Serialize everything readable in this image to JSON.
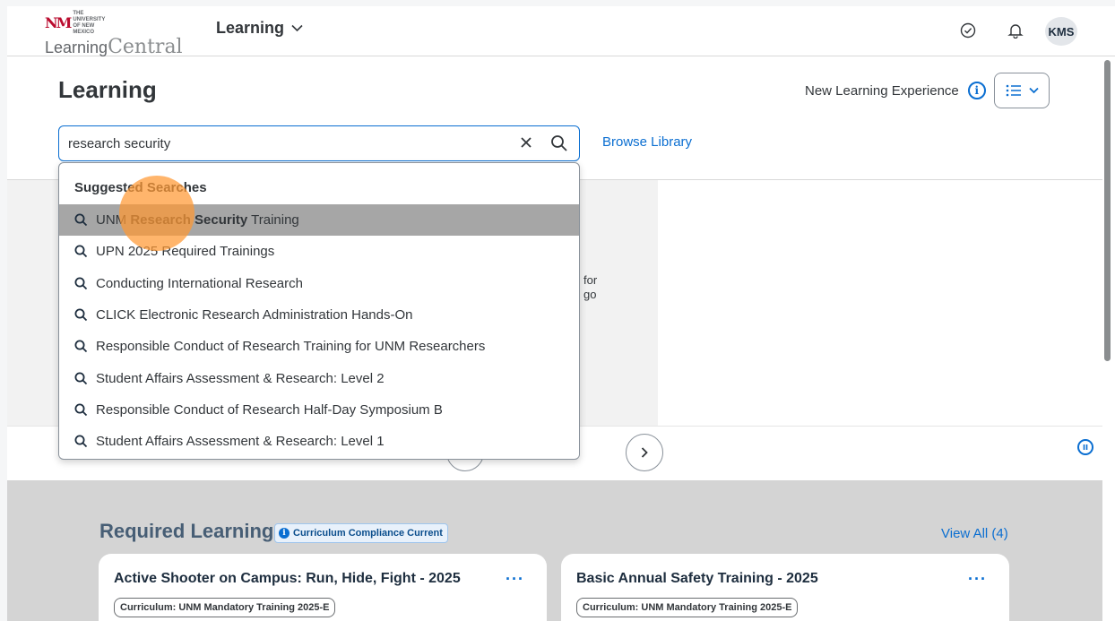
{
  "header": {
    "logo_university": "THE UNIVERSITY OF NEW MEXICO",
    "logo_name_part1": "Learning",
    "logo_name_part2": "Central",
    "app_switcher_label": "Learning",
    "user_initials": "KMS",
    "icons": [
      "approvals-icon",
      "bell-icon",
      "chevron-down-icon"
    ]
  },
  "learning": {
    "title": "Learning",
    "new_experience_label": "New Learning Experience",
    "browse_library": "Browse Library"
  },
  "search": {
    "value": "research security",
    "suggested_heading": "Suggested Searches",
    "suggestions": [
      {
        "pre": "UNM ",
        "bold": "Research Security",
        "post": " Training",
        "highlighted": true
      },
      {
        "pre": "UPN 2025 Required Trainings",
        "bold": "",
        "post": "",
        "highlighted": false
      },
      {
        "pre": "Conducting International Research",
        "bold": "",
        "post": "",
        "highlighted": false
      },
      {
        "pre": "CLICK Electronic Research Administration Hands-On",
        "bold": "",
        "post": "",
        "highlighted": false
      },
      {
        "pre": "Responsible Conduct of Research Training for UNM Researchers",
        "bold": "",
        "post": "",
        "highlighted": false
      },
      {
        "pre": "Student Affairs Assessment & Research: Level 2",
        "bold": "",
        "post": "",
        "highlighted": false
      },
      {
        "pre": "Responsible Conduct of Research Half-Day Symposium B",
        "bold": "",
        "post": "",
        "highlighted": false
      },
      {
        "pre": "Student Affairs Assessment & Research: Level 1",
        "bold": "",
        "post": "",
        "highlighted": false
      }
    ]
  },
  "carousel": {
    "partial_text_line1": "for",
    "partial_text_line2": "go",
    "next_label": "›"
  },
  "required_learning": {
    "title": "Required Learning",
    "compliance_badge": "Curriculum Compliance Current",
    "view_all": "View All (4)",
    "cards": [
      {
        "title": "Active Shooter on Campus: Run, Hide, Fight - 2025",
        "tag": "Curriculum: UNM Mandatory Training 2025-E"
      },
      {
        "title": "Basic Annual Safety Training - 2025",
        "tag": "Curriculum: UNM Mandatory Training 2025-E"
      }
    ]
  },
  "colors": {
    "accent": "#0a6ed1",
    "unm_red": "#ba0c2f",
    "highlight_row": "#a6a6a6",
    "cursor_marker": "#ff9933",
    "section_bg": "#d4d4d4"
  }
}
